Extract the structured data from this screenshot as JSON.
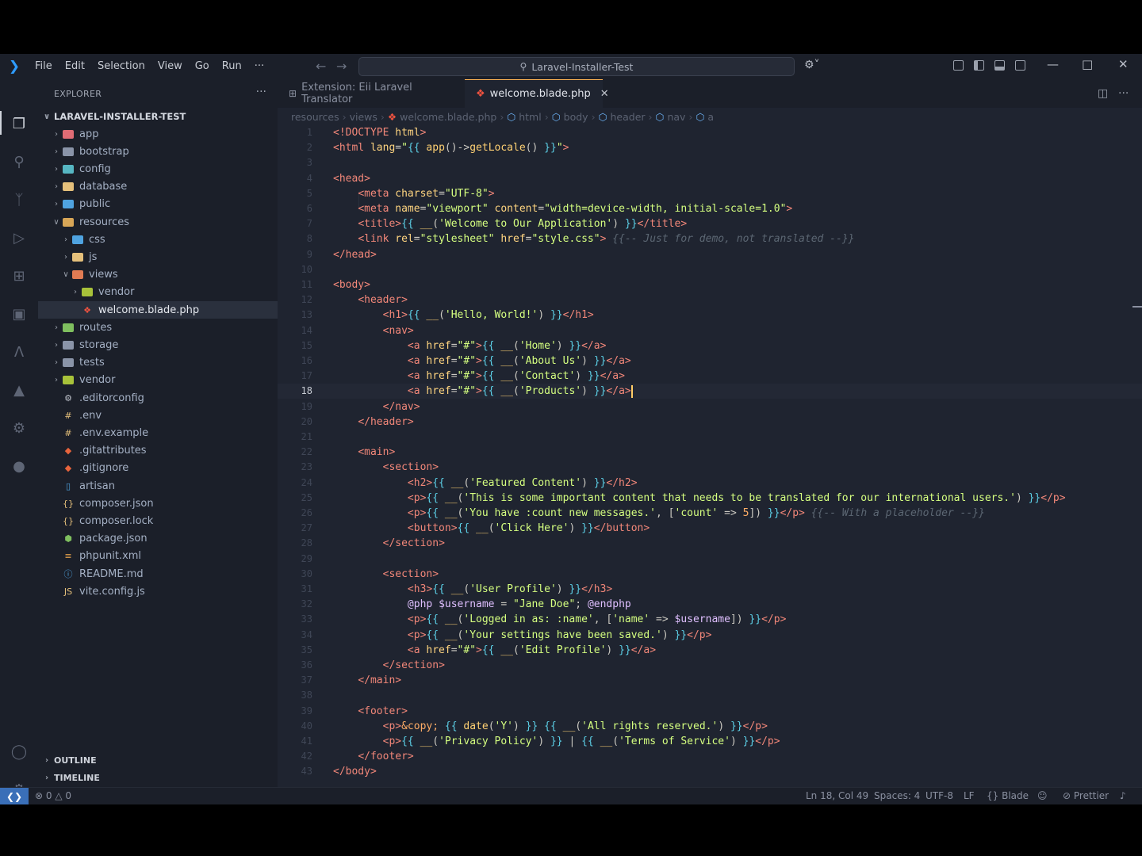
{
  "titlebar": {
    "menu": [
      "File",
      "Edit",
      "Selection",
      "View",
      "Go",
      "Run",
      "···"
    ],
    "search_text": "Laravel-Installer-Test"
  },
  "sidebar": {
    "header": "EXPLORER",
    "root": "LARAVEL-INSTALLER-TEST",
    "items": [
      {
        "label": "app",
        "type": "folder",
        "color": "#e06c75"
      },
      {
        "label": "bootstrap",
        "type": "folder",
        "color": "#8a94a8"
      },
      {
        "label": "config",
        "type": "folder",
        "color": "#56b6c2"
      },
      {
        "label": "database",
        "type": "folder",
        "color": "#e5c07b"
      },
      {
        "label": "public",
        "type": "folder",
        "color": "#4fa3e0"
      },
      {
        "label": "resources",
        "type": "folder-open",
        "color": "#d8a657"
      },
      {
        "label": "css",
        "type": "folder",
        "color": "#4fa3e0"
      },
      {
        "label": "js",
        "type": "folder",
        "color": "#e5c07b"
      },
      {
        "label": "views",
        "type": "folder-open",
        "color": "#e07b53"
      },
      {
        "label": "vendor",
        "type": "folder",
        "color": "#a8c23a"
      },
      {
        "label": "welcome.blade.php",
        "type": "blade-file",
        "color": "#f05340"
      },
      {
        "label": "routes",
        "type": "folder",
        "color": "#7fbf5f"
      },
      {
        "label": "storage",
        "type": "folder",
        "color": "#8a94a8"
      },
      {
        "label": "tests",
        "type": "folder",
        "color": "#8a94a8"
      },
      {
        "label": "vendor",
        "type": "folder",
        "color": "#a8c23a"
      },
      {
        "label": ".editorconfig",
        "type": "gear-file",
        "color": "#c0c4cc"
      },
      {
        "label": ".env",
        "type": "env-file",
        "color": "#e5c07b"
      },
      {
        "label": ".env.example",
        "type": "env-file",
        "color": "#e5c07b"
      },
      {
        "label": ".gitattributes",
        "type": "git-file",
        "color": "#e8643c"
      },
      {
        "label": ".gitignore",
        "type": "git-file",
        "color": "#e8643c"
      },
      {
        "label": "artisan",
        "type": "text-file",
        "color": "#4fa3e0"
      },
      {
        "label": "composer.json",
        "type": "json-file",
        "color": "#e5c07b"
      },
      {
        "label": "composer.lock",
        "type": "json-file",
        "color": "#e5c07b"
      },
      {
        "label": "package.json",
        "type": "node-file",
        "color": "#7fbf5f"
      },
      {
        "label": "phpunit.xml",
        "type": "xml-file",
        "color": "#e5a04b"
      },
      {
        "label": "README.md",
        "type": "info-file",
        "color": "#4fa3e0"
      },
      {
        "label": "vite.config.js",
        "type": "js-file",
        "color": "#e5c07b"
      }
    ],
    "outline": "OUTLINE",
    "timeline": "TIMELINE"
  },
  "tabs": [
    {
      "label": "Extension: Eii Laravel Translator",
      "active": false
    },
    {
      "label": "welcome.blade.php",
      "active": true
    }
  ],
  "breadcrumb": [
    "resources",
    "views",
    "welcome.blade.php",
    "html",
    "body",
    "header",
    "nav",
    "a"
  ],
  "editor": {
    "current_line": 18,
    "lines": [
      [
        [
          "t",
          "<!DOCTYPE "
        ],
        [
          "a",
          "html"
        ],
        [
          "t",
          ">"
        ]
      ],
      [
        [
          "t",
          "<html "
        ],
        [
          "a",
          "lang"
        ],
        [
          "p",
          "="
        ],
        [
          "s",
          "\""
        ],
        [
          "b",
          "{{ "
        ],
        [
          "f",
          "app"
        ],
        [
          "p",
          "()->"
        ],
        [
          "f",
          "getLocale"
        ],
        [
          "p",
          "() "
        ],
        [
          "b",
          "}}"
        ],
        [
          "s",
          "\""
        ],
        [
          "t",
          ">"
        ]
      ],
      [],
      [
        [
          "t",
          "<head>"
        ]
      ],
      [
        [
          "p",
          "    "
        ],
        [
          "t",
          "<meta "
        ],
        [
          "a",
          "charset"
        ],
        [
          "p",
          "="
        ],
        [
          "s",
          "\"UTF-8\""
        ],
        [
          "t",
          ">"
        ]
      ],
      [
        [
          "p",
          "    "
        ],
        [
          "t",
          "<meta "
        ],
        [
          "a",
          "name"
        ],
        [
          "p",
          "="
        ],
        [
          "s",
          "\"viewport\""
        ],
        [
          "p",
          " "
        ],
        [
          "a",
          "content"
        ],
        [
          "p",
          "="
        ],
        [
          "s",
          "\"width=device-width, initial-scale=1.0\""
        ],
        [
          "t",
          ">"
        ]
      ],
      [
        [
          "p",
          "    "
        ],
        [
          "t",
          "<title>"
        ],
        [
          "b",
          "{{ "
        ],
        [
          "f",
          "__"
        ],
        [
          "p",
          "("
        ],
        [
          "s",
          "'Welcome to Our Application'"
        ],
        [
          "p",
          ") "
        ],
        [
          "b",
          "}}"
        ],
        [
          "t",
          "</title>"
        ]
      ],
      [
        [
          "p",
          "    "
        ],
        [
          "t",
          "<link "
        ],
        [
          "a",
          "rel"
        ],
        [
          "p",
          "="
        ],
        [
          "s",
          "\"stylesheet\""
        ],
        [
          "p",
          " "
        ],
        [
          "a",
          "href"
        ],
        [
          "p",
          "="
        ],
        [
          "s",
          "\"style.css\""
        ],
        [
          "t",
          ">"
        ],
        [
          "p",
          " "
        ],
        [
          "c",
          "{{-- Just for demo, not translated --}}"
        ]
      ],
      [
        [
          "t",
          "</head>"
        ]
      ],
      [],
      [
        [
          "t",
          "<body>"
        ]
      ],
      [
        [
          "p",
          "    "
        ],
        [
          "t",
          "<header>"
        ]
      ],
      [
        [
          "p",
          "        "
        ],
        [
          "t",
          "<h1>"
        ],
        [
          "b",
          "{{ "
        ],
        [
          "f",
          "__"
        ],
        [
          "p",
          "("
        ],
        [
          "s",
          "'Hello, World!'"
        ],
        [
          "p",
          ") "
        ],
        [
          "b",
          "}}"
        ],
        [
          "t",
          "</h1>"
        ]
      ],
      [
        [
          "p",
          "        "
        ],
        [
          "t",
          "<nav>"
        ]
      ],
      [
        [
          "p",
          "            "
        ],
        [
          "t",
          "<a "
        ],
        [
          "a",
          "href"
        ],
        [
          "p",
          "="
        ],
        [
          "s",
          "\"#\""
        ],
        [
          "t",
          ">"
        ],
        [
          "b",
          "{{ "
        ],
        [
          "f",
          "__"
        ],
        [
          "p",
          "("
        ],
        [
          "s",
          "'Home'"
        ],
        [
          "p",
          ") "
        ],
        [
          "b",
          "}}"
        ],
        [
          "t",
          "</a>"
        ]
      ],
      [
        [
          "p",
          "            "
        ],
        [
          "t",
          "<a "
        ],
        [
          "a",
          "href"
        ],
        [
          "p",
          "="
        ],
        [
          "s",
          "\"#\""
        ],
        [
          "t",
          ">"
        ],
        [
          "b",
          "{{ "
        ],
        [
          "f",
          "__"
        ],
        [
          "p",
          "("
        ],
        [
          "s",
          "'About Us'"
        ],
        [
          "p",
          ") "
        ],
        [
          "b",
          "}}"
        ],
        [
          "t",
          "</a>"
        ]
      ],
      [
        [
          "p",
          "            "
        ],
        [
          "t",
          "<a "
        ],
        [
          "a",
          "href"
        ],
        [
          "p",
          "="
        ],
        [
          "s",
          "\"#\""
        ],
        [
          "t",
          ">"
        ],
        [
          "b",
          "{{ "
        ],
        [
          "f",
          "__"
        ],
        [
          "p",
          "("
        ],
        [
          "s",
          "'Contact'"
        ],
        [
          "p",
          ") "
        ],
        [
          "b",
          "}}"
        ],
        [
          "t",
          "</a>"
        ]
      ],
      [
        [
          "p",
          "            "
        ],
        [
          "t",
          "<a "
        ],
        [
          "a",
          "href"
        ],
        [
          "p",
          "="
        ],
        [
          "s",
          "\"#\""
        ],
        [
          "t",
          ">"
        ],
        [
          "b",
          "{{ "
        ],
        [
          "f",
          "__"
        ],
        [
          "p",
          "("
        ],
        [
          "s",
          "'Products'"
        ],
        [
          "p",
          ") "
        ],
        [
          "b",
          "}}"
        ],
        [
          "t",
          "</a>"
        ]
      ],
      [
        [
          "p",
          "        "
        ],
        [
          "t",
          "</nav>"
        ]
      ],
      [
        [
          "p",
          "    "
        ],
        [
          "t",
          "</header>"
        ]
      ],
      [],
      [
        [
          "p",
          "    "
        ],
        [
          "t",
          "<main>"
        ]
      ],
      [
        [
          "p",
          "        "
        ],
        [
          "t",
          "<section>"
        ]
      ],
      [
        [
          "p",
          "            "
        ],
        [
          "t",
          "<h2>"
        ],
        [
          "b",
          "{{ "
        ],
        [
          "f",
          "__"
        ],
        [
          "p",
          "("
        ],
        [
          "s",
          "'Featured Content'"
        ],
        [
          "p",
          ") "
        ],
        [
          "b",
          "}}"
        ],
        [
          "t",
          "</h2>"
        ]
      ],
      [
        [
          "p",
          "            "
        ],
        [
          "t",
          "<p>"
        ],
        [
          "b",
          "{{ "
        ],
        [
          "f",
          "__"
        ],
        [
          "p",
          "("
        ],
        [
          "s",
          "'This is some important content that needs to be translated for our international users.'"
        ],
        [
          "p",
          ") "
        ],
        [
          "b",
          "}}"
        ],
        [
          "t",
          "</p>"
        ]
      ],
      [
        [
          "p",
          "            "
        ],
        [
          "t",
          "<p>"
        ],
        [
          "b",
          "{{ "
        ],
        [
          "f",
          "__"
        ],
        [
          "p",
          "("
        ],
        [
          "s",
          "'You have :count new messages.'"
        ],
        [
          "p",
          ", ["
        ],
        [
          "s",
          "'count'"
        ],
        [
          "p",
          " => "
        ],
        [
          "k",
          "5"
        ],
        [
          "p",
          "]) "
        ],
        [
          "b",
          "}}"
        ],
        [
          "t",
          "</p>"
        ],
        [
          "p",
          " "
        ],
        [
          "c",
          "{{-- With a placeholder --}}"
        ]
      ],
      [
        [
          "p",
          "            "
        ],
        [
          "t",
          "<button>"
        ],
        [
          "b",
          "{{ "
        ],
        [
          "f",
          "__"
        ],
        [
          "p",
          "("
        ],
        [
          "s",
          "'Click Here'"
        ],
        [
          "p",
          ") "
        ],
        [
          "b",
          "}}"
        ],
        [
          "t",
          "</button>"
        ]
      ],
      [
        [
          "p",
          "        "
        ],
        [
          "t",
          "</section>"
        ]
      ],
      [],
      [
        [
          "p",
          "        "
        ],
        [
          "t",
          "<section>"
        ]
      ],
      [
        [
          "p",
          "            "
        ],
        [
          "t",
          "<h3>"
        ],
        [
          "b",
          "{{ "
        ],
        [
          "f",
          "__"
        ],
        [
          "p",
          "("
        ],
        [
          "s",
          "'User Profile'"
        ],
        [
          "p",
          ") "
        ],
        [
          "b",
          "}}"
        ],
        [
          "t",
          "</h3>"
        ]
      ],
      [
        [
          "p",
          "            "
        ],
        [
          "v",
          "@php"
        ],
        [
          "p",
          " "
        ],
        [
          "v",
          "$username"
        ],
        [
          "p",
          " = "
        ],
        [
          "s",
          "\"Jane Doe\""
        ],
        [
          "p",
          "; "
        ],
        [
          "v",
          "@endphp"
        ]
      ],
      [
        [
          "p",
          "            "
        ],
        [
          "t",
          "<p>"
        ],
        [
          "b",
          "{{ "
        ],
        [
          "f",
          "__"
        ],
        [
          "p",
          "("
        ],
        [
          "s",
          "'Logged in as: :name'"
        ],
        [
          "p",
          ", ["
        ],
        [
          "s",
          "'name'"
        ],
        [
          "p",
          " => "
        ],
        [
          "v",
          "$username"
        ],
        [
          "p",
          "]) "
        ],
        [
          "b",
          "}}"
        ],
        [
          "t",
          "</p>"
        ]
      ],
      [
        [
          "p",
          "            "
        ],
        [
          "t",
          "<p>"
        ],
        [
          "b",
          "{{ "
        ],
        [
          "f",
          "__"
        ],
        [
          "p",
          "("
        ],
        [
          "s",
          "'Your settings have been saved.'"
        ],
        [
          "p",
          ") "
        ],
        [
          "b",
          "}}"
        ],
        [
          "t",
          "</p>"
        ]
      ],
      [
        [
          "p",
          "            "
        ],
        [
          "t",
          "<a "
        ],
        [
          "a",
          "href"
        ],
        [
          "p",
          "="
        ],
        [
          "s",
          "\"#\""
        ],
        [
          "t",
          ">"
        ],
        [
          "b",
          "{{ "
        ],
        [
          "f",
          "__"
        ],
        [
          "p",
          "("
        ],
        [
          "s",
          "'Edit Profile'"
        ],
        [
          "p",
          ") "
        ],
        [
          "b",
          "}}"
        ],
        [
          "t",
          "</a>"
        ]
      ],
      [
        [
          "p",
          "        "
        ],
        [
          "t",
          "</section>"
        ]
      ],
      [
        [
          "p",
          "    "
        ],
        [
          "t",
          "</main>"
        ]
      ],
      [],
      [
        [
          "p",
          "    "
        ],
        [
          "t",
          "<footer>"
        ]
      ],
      [
        [
          "p",
          "        "
        ],
        [
          "t",
          "<p>"
        ],
        [
          "k",
          "&copy;"
        ],
        [
          "p",
          " "
        ],
        [
          "b",
          "{{ "
        ],
        [
          "f",
          "date"
        ],
        [
          "p",
          "("
        ],
        [
          "s",
          "'Y'"
        ],
        [
          "p",
          ") "
        ],
        [
          "b",
          "}}"
        ],
        [
          "p",
          " "
        ],
        [
          "b",
          "{{ "
        ],
        [
          "f",
          "__"
        ],
        [
          "p",
          "("
        ],
        [
          "s",
          "'All rights reserved.'"
        ],
        [
          "p",
          ") "
        ],
        [
          "b",
          "}}"
        ],
        [
          "t",
          "</p>"
        ]
      ],
      [
        [
          "p",
          "        "
        ],
        [
          "t",
          "<p>"
        ],
        [
          "b",
          "{{ "
        ],
        [
          "f",
          "__"
        ],
        [
          "p",
          "("
        ],
        [
          "s",
          "'Privacy Policy'"
        ],
        [
          "p",
          ") "
        ],
        [
          "b",
          "}}"
        ],
        [
          "p",
          " | "
        ],
        [
          "b",
          "{{ "
        ],
        [
          "f",
          "__"
        ],
        [
          "p",
          "("
        ],
        [
          "s",
          "'Terms of Service'"
        ],
        [
          "p",
          ") "
        ],
        [
          "b",
          "}}"
        ],
        [
          "t",
          "</p>"
        ]
      ],
      [
        [
          "p",
          "    "
        ],
        [
          "t",
          "</footer>"
        ]
      ],
      [
        [
          "t",
          "</body>"
        ]
      ]
    ]
  },
  "statusbar": {
    "errors": "0",
    "warnings": "0",
    "position": "Ln 18, Col 49",
    "spaces": "Spaces: 4",
    "encoding": "UTF-8",
    "eol": "LF",
    "language": "Blade",
    "formatter": "Prettier"
  }
}
